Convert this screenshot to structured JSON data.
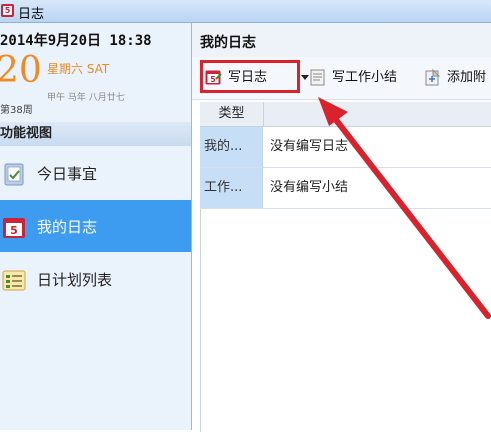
{
  "window": {
    "title": "日志"
  },
  "calendar": {
    "date_line": "2014年9月20日 18:38",
    "day": "20",
    "weekday": "星期六 SAT",
    "lunar": "甲午 马年 八月廿七",
    "week_number": "第38周"
  },
  "sidebar": {
    "section_title": "功能视图",
    "items": [
      {
        "label": "今日事宜"
      },
      {
        "label": "我的日志"
      },
      {
        "label": "日计划列表"
      }
    ]
  },
  "main": {
    "title": "我的日志",
    "toolbar": {
      "write_log": "写日志",
      "write_summary": "写工作小结",
      "add_attachment": "添加附"
    },
    "table": {
      "header": "类型",
      "rows": [
        {
          "type": "我的...",
          "content": "没有编写日志"
        },
        {
          "type": "工作...",
          "content": "没有编写小结"
        }
      ]
    }
  },
  "colors": {
    "highlight": "#d8222c",
    "selected": "#3d9bf0",
    "accent": "#f08a24"
  }
}
